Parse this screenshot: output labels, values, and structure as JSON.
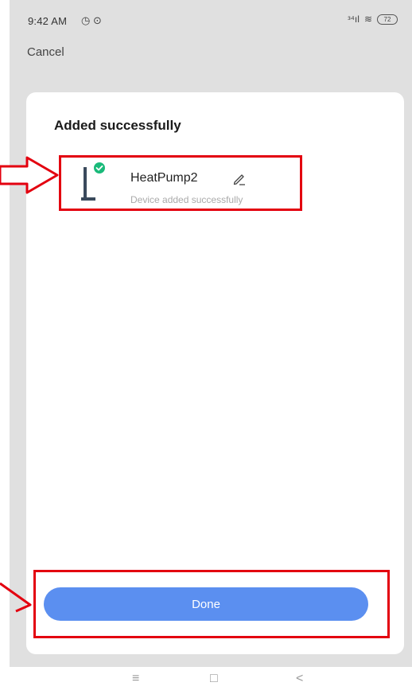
{
  "status_bar": {
    "time": "9:42 AM",
    "left_icons": "◷ ⊙",
    "signal": "ᵌ⁴ıl",
    "wifi": "≋",
    "battery": "72"
  },
  "header": {
    "cancel_label": "Cancel"
  },
  "dialog": {
    "title": "Added successfully",
    "device": {
      "name": "HeatPump2",
      "status": "Device added successfully",
      "icon": "heat-pump-icon",
      "badge_icon": "check-circle-icon"
    },
    "done_label": "Done"
  },
  "annotations": {
    "highlight_color": "#e3000f"
  },
  "colors": {
    "accent": "#5b8ff0",
    "success": "#1aba7a"
  },
  "nav_bar": {
    "menu_glyph": "≡",
    "home_glyph": "□",
    "back_glyph": "<"
  }
}
